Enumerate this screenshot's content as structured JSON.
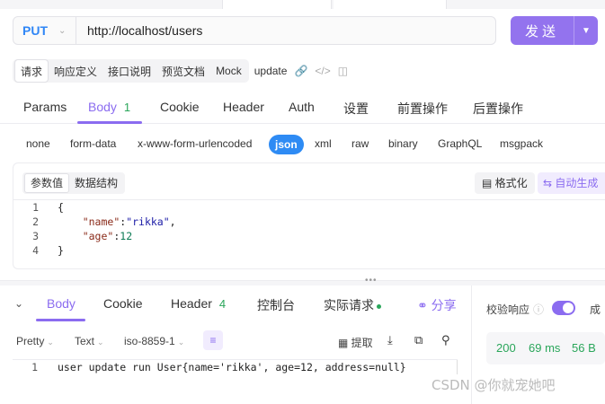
{
  "request": {
    "method": "PUT",
    "url": "http://localhost/users",
    "send_label": "发送"
  },
  "doc_tabs": [
    "请求",
    "响应定义",
    "接口说明",
    "预览文档",
    "Mock"
  ],
  "doc_name": "update",
  "req_tabs": [
    {
      "label": "Params"
    },
    {
      "label": "Body",
      "count": "1"
    },
    {
      "label": "Cookie"
    },
    {
      "label": "Header"
    },
    {
      "label": "Auth"
    },
    {
      "label": "设置"
    },
    {
      "label": "前置操作"
    },
    {
      "label": "后置操作"
    }
  ],
  "body_types": [
    "none",
    "form-data",
    "x-www-form-urlencoded",
    "json",
    "xml",
    "raw",
    "binary",
    "GraphQL",
    "msgpack"
  ],
  "selected_body_type": "json",
  "editor": {
    "tabs": [
      "参数值",
      "数据结构"
    ],
    "format_label": "格式化",
    "auto_label": "自动生成",
    "lines": [
      {
        "no": "1",
        "text": "{"
      },
      {
        "no": "2",
        "key": "\"name\"",
        "value": "\"rikka\"",
        "trail": ","
      },
      {
        "no": "3",
        "key": "\"age\"",
        "value": "12",
        "trail": ""
      },
      {
        "no": "4",
        "text": "}"
      }
    ]
  },
  "response": {
    "tabs": [
      {
        "label": "Body"
      },
      {
        "label": "Cookie"
      },
      {
        "label": "Header",
        "count": "4"
      },
      {
        "label": "控制台"
      },
      {
        "label": "实际请求"
      }
    ],
    "share_label": "分享",
    "format": "Pretty",
    "type": "Text",
    "encoding": "iso-8859-1",
    "extract_label": "提取",
    "line_no": "1",
    "text": "user update run User{name='rikka', age=12, address=null}"
  },
  "validation": {
    "label": "校验响应",
    "result": "成"
  },
  "stats": {
    "status": "200",
    "time": "69 ms",
    "size": "56 B"
  },
  "watermark": "CSDN @你就宠她吧"
}
